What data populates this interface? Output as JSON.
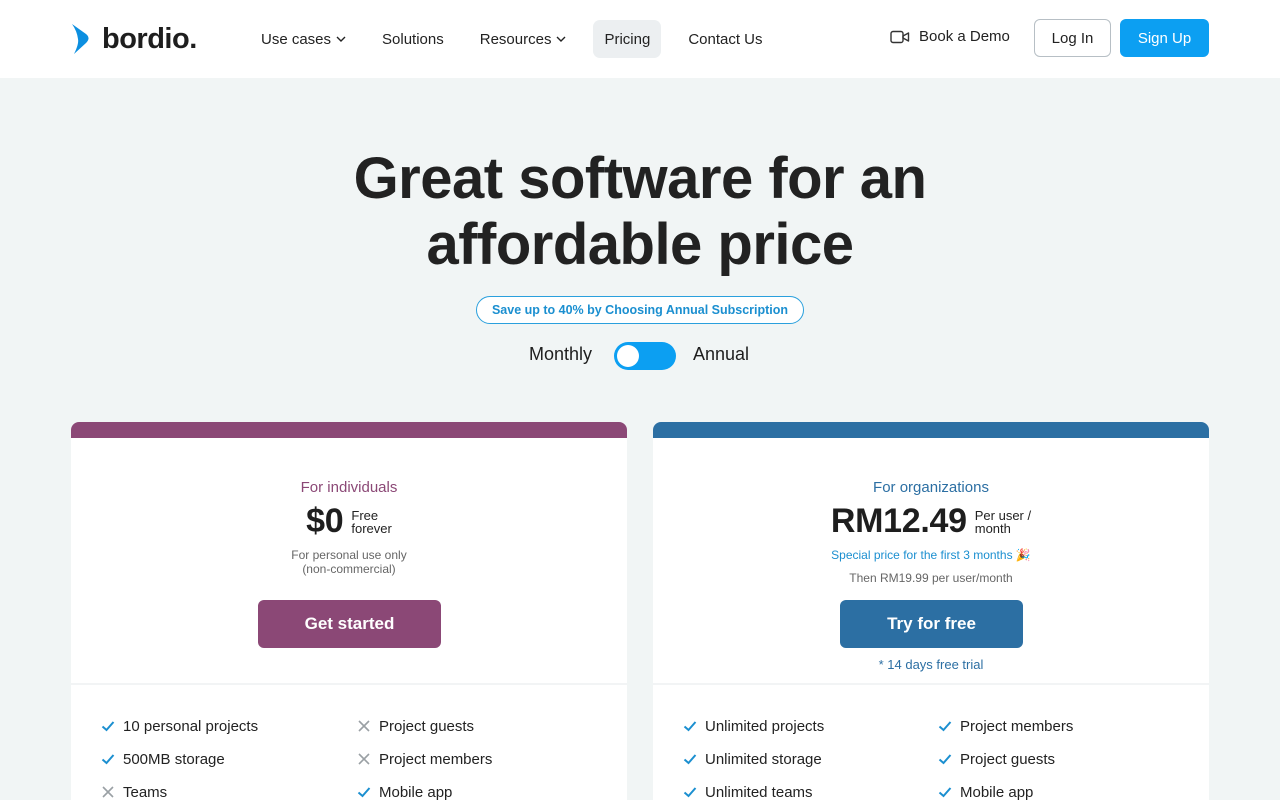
{
  "header": {
    "logo_text": "bordio.",
    "nav": [
      {
        "label": "Use cases",
        "has_dropdown": true
      },
      {
        "label": "Solutions",
        "has_dropdown": false
      },
      {
        "label": "Resources",
        "has_dropdown": true
      },
      {
        "label": "Pricing",
        "has_dropdown": false,
        "active": true
      },
      {
        "label": "Contact Us",
        "has_dropdown": false
      }
    ],
    "book_demo": "Book a Demo",
    "login": "Log In",
    "signup": "Sign Up"
  },
  "hero": {
    "title_line1": "Great software for an",
    "title_line2": "affordable price",
    "badge": "Save up to 40% by Choosing Annual Subscription",
    "billing": {
      "monthly": "Monthly",
      "annual": "Annual",
      "selected": "Monthly"
    }
  },
  "plans": {
    "individuals": {
      "name": "For individuals",
      "price": "$0",
      "price_note_1": "Free",
      "price_note_2": "forever",
      "note_1": "For personal use only",
      "note_2": "(non-commercial)",
      "cta": "Get started",
      "features_col1": [
        {
          "label": "10 personal projects",
          "included": true
        },
        {
          "label": "500MB storage",
          "included": true
        },
        {
          "label": "Teams",
          "included": false
        }
      ],
      "features_col2": [
        {
          "label": "Project guests",
          "included": false
        },
        {
          "label": "Project members",
          "included": false
        },
        {
          "label": "Mobile app",
          "included": true
        }
      ]
    },
    "organizations": {
      "name": "For organizations",
      "price": "RM12.49",
      "price_note_1": "Per user /",
      "price_note_2": "month",
      "special": "Special price for the first 3 months 🎉",
      "then": "Then RM19.99 per user/month",
      "cta": "Try for free",
      "trial": "* 14 days free trial",
      "features_col1": [
        {
          "label": "Unlimited projects",
          "included": true
        },
        {
          "label": "Unlimited storage",
          "included": true
        },
        {
          "label": "Unlimited teams",
          "included": true
        }
      ],
      "features_col2": [
        {
          "label": "Project members",
          "included": true
        },
        {
          "label": "Project guests",
          "included": true
        },
        {
          "label": "Mobile app",
          "included": true
        }
      ]
    }
  },
  "colors": {
    "brand_blue": "#0c9ff2",
    "individuals_accent": "#8b4876",
    "organizations_accent": "#2c6fa3",
    "page_bg": "#f1f5f5"
  }
}
